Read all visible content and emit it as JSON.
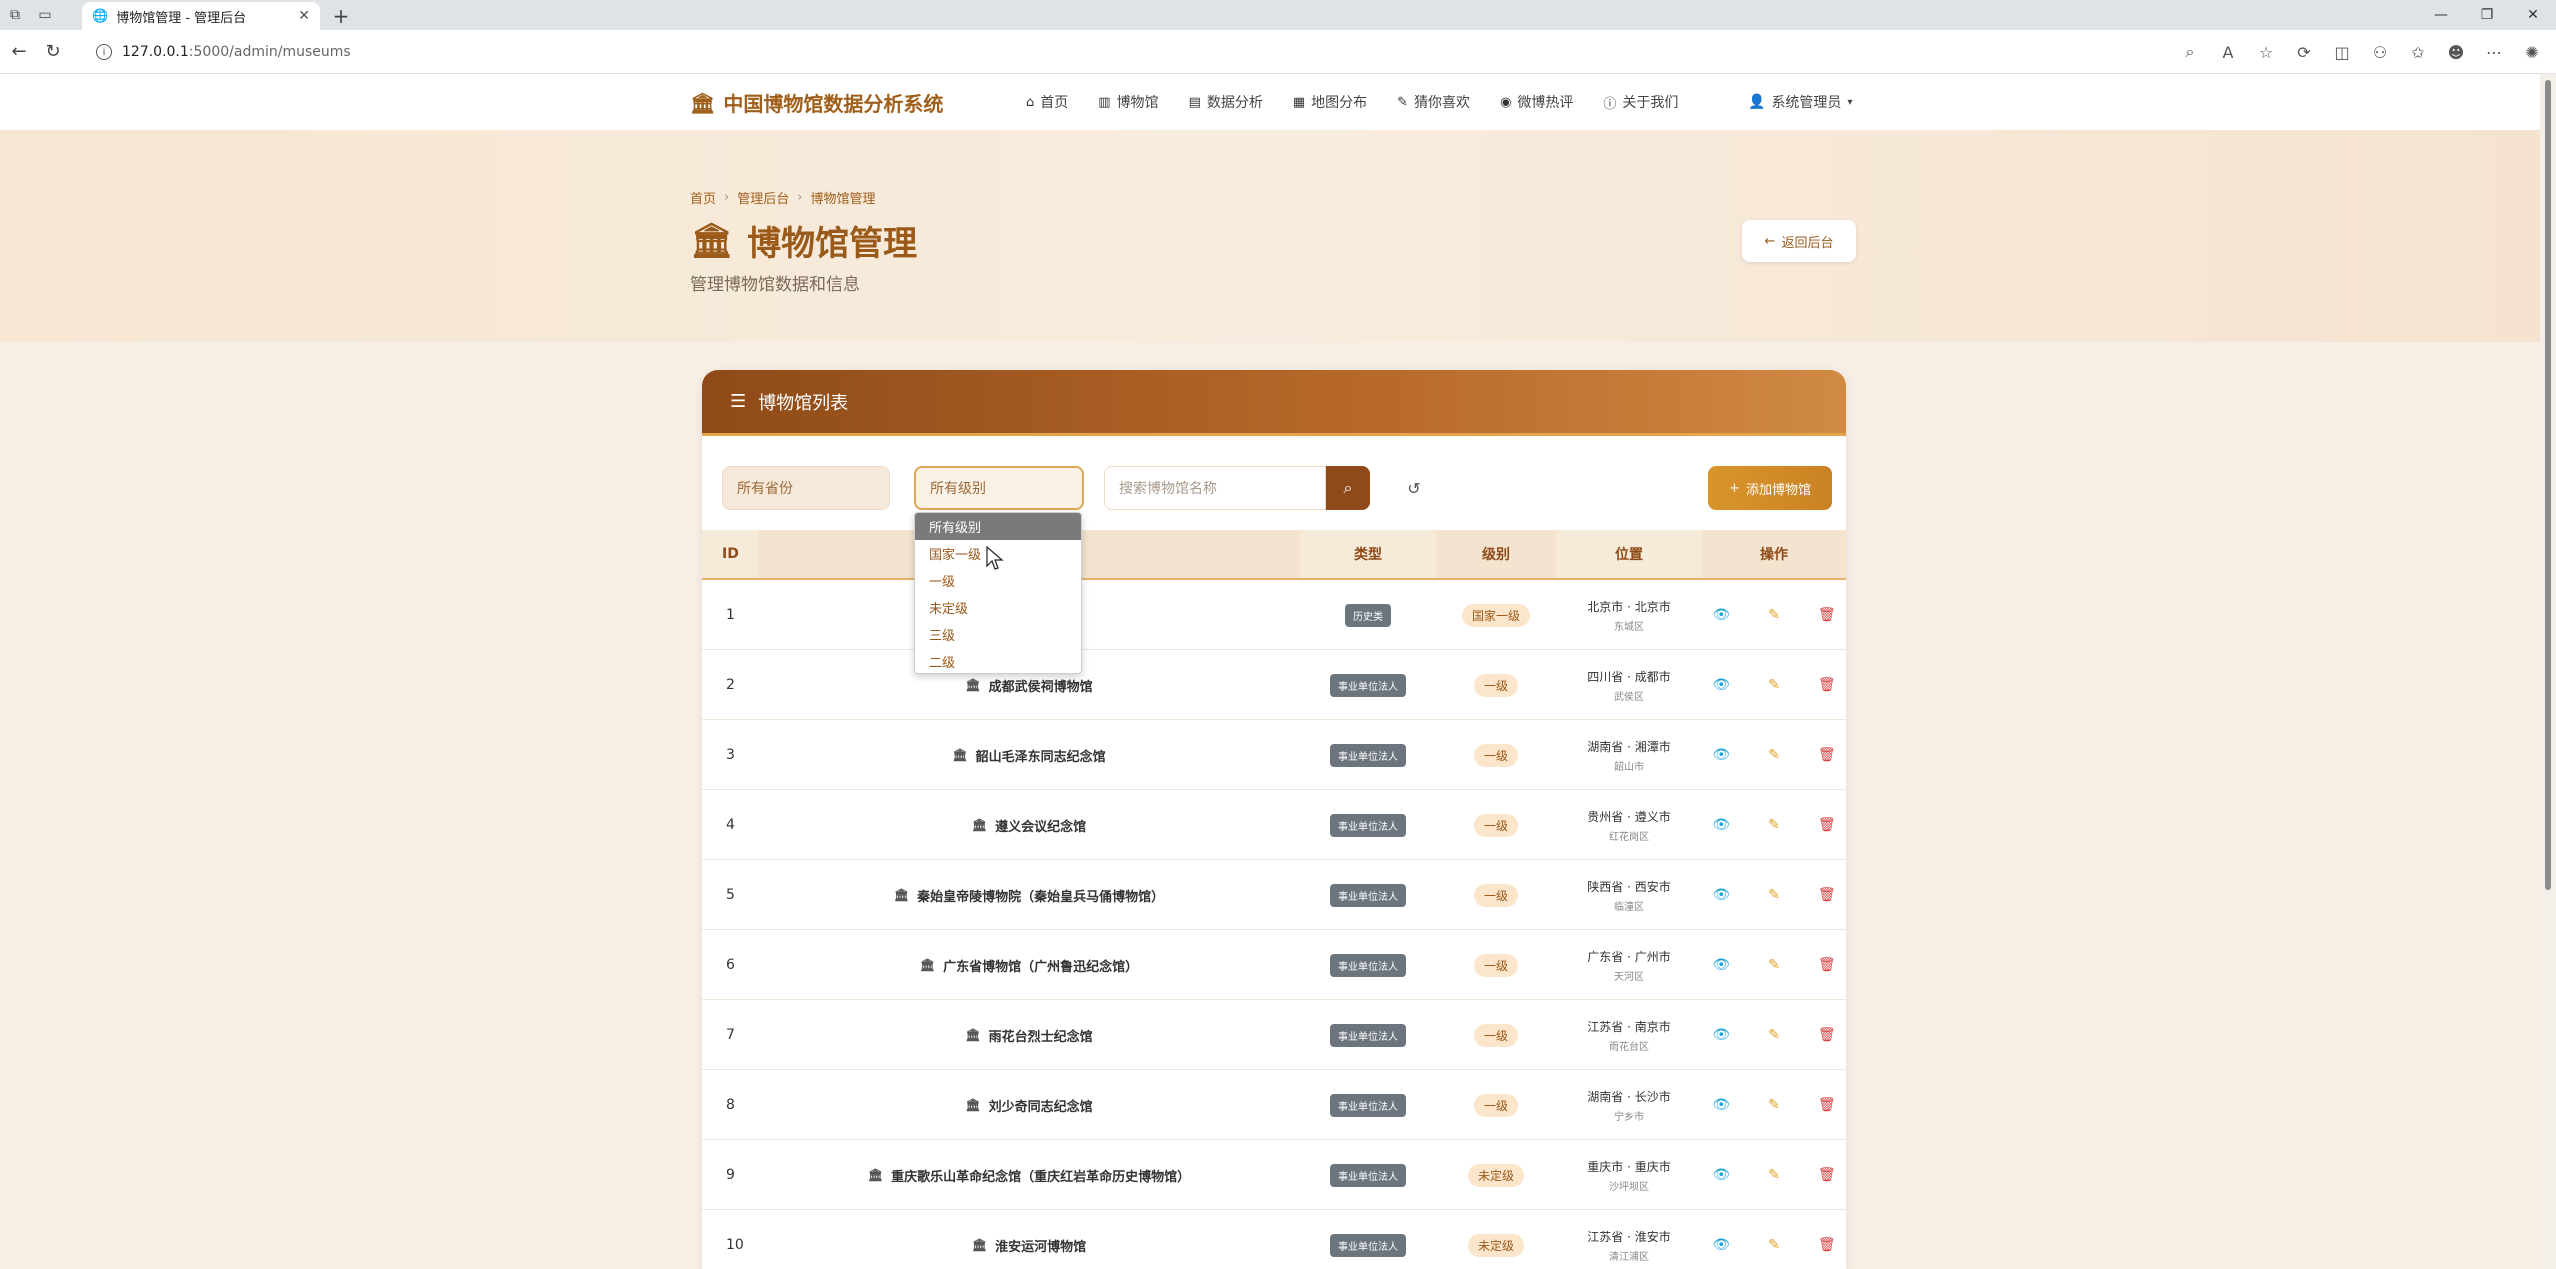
{
  "browser": {
    "tab_title": "博物馆管理 - 管理后台",
    "url_host": "127.0.0.1",
    "url_rest": ":5000/admin/museums"
  },
  "navbar": {
    "brand": "中国博物馆数据分析系统",
    "links": [
      {
        "label": "首页",
        "icon": "home-icon"
      },
      {
        "label": "博物馆",
        "icon": "building-icon"
      },
      {
        "label": "数据分析",
        "icon": "chart-icon"
      },
      {
        "label": "地图分布",
        "icon": "map-icon"
      },
      {
        "label": "猜你喜欢",
        "icon": "pencil-icon"
      },
      {
        "label": "微博热评",
        "icon": "weibo-icon"
      },
      {
        "label": "关于我们",
        "icon": "info-icon"
      }
    ],
    "user": "系统管理员"
  },
  "header": {
    "breadcrumb": [
      "首页",
      "管理后台",
      "博物馆管理"
    ],
    "title": "博物馆管理",
    "subtitle": "管理博物馆数据和信息",
    "back_button": "返回后台"
  },
  "card": {
    "title": "博物馆列表",
    "province_select": "所有省份",
    "level_select": "所有级别",
    "search_placeholder": "搜索博物馆名称",
    "add_button": "添加博物馆"
  },
  "table": {
    "headers": {
      "id": "ID",
      "name": "",
      "type": "类型",
      "level": "级别",
      "location": "位置",
      "ops": "操作"
    },
    "rows": [
      {
        "id": "1",
        "name": "",
        "type": "历史类",
        "level": "国家一级",
        "loc1": "北京市 · 北京市",
        "loc2": "东城区"
      },
      {
        "id": "2",
        "name": "成都武侯祠博物馆",
        "type": "事业单位法人",
        "level": "一级",
        "loc1": "四川省 · 成都市",
        "loc2": "武侯区"
      },
      {
        "id": "3",
        "name": "韶山毛泽东同志纪念馆",
        "type": "事业单位法人",
        "level": "一级",
        "loc1": "湖南省 · 湘潭市",
        "loc2": "韶山市"
      },
      {
        "id": "4",
        "name": "遵义会议纪念馆",
        "type": "事业单位法人",
        "level": "一级",
        "loc1": "贵州省 · 遵义市",
        "loc2": "红花岗区"
      },
      {
        "id": "5",
        "name": "秦始皇帝陵博物院（秦始皇兵马俑博物馆）",
        "type": "事业单位法人",
        "level": "一级",
        "loc1": "陕西省 · 西安市",
        "loc2": "临潼区"
      },
      {
        "id": "6",
        "name": "广东省博物馆（广州鲁迅纪念馆）",
        "type": "事业单位法人",
        "level": "一级",
        "loc1": "广东省 · 广州市",
        "loc2": "天河区"
      },
      {
        "id": "7",
        "name": "雨花台烈士纪念馆",
        "type": "事业单位法人",
        "level": "一级",
        "loc1": "江苏省 · 南京市",
        "loc2": "雨花台区"
      },
      {
        "id": "8",
        "name": "刘少奇同志纪念馆",
        "type": "事业单位法人",
        "level": "一级",
        "loc1": "湖南省 · 长沙市",
        "loc2": "宁乡市"
      },
      {
        "id": "9",
        "name": "重庆歌乐山革命纪念馆（重庆红岩革命历史博物馆）",
        "type": "事业单位法人",
        "level": "未定级",
        "loc1": "重庆市 · 重庆市",
        "loc2": "沙坪坝区"
      },
      {
        "id": "10",
        "name": "淮安运河博物馆",
        "type": "事业单位法人",
        "level": "未定级",
        "loc1": "江苏省 · 淮安市",
        "loc2": "清江浦区"
      }
    ]
  },
  "dropdown": {
    "options": [
      "所有级别",
      "国家一级",
      "一级",
      "未定级",
      "三级",
      "二级"
    ],
    "selected_index": 0
  }
}
